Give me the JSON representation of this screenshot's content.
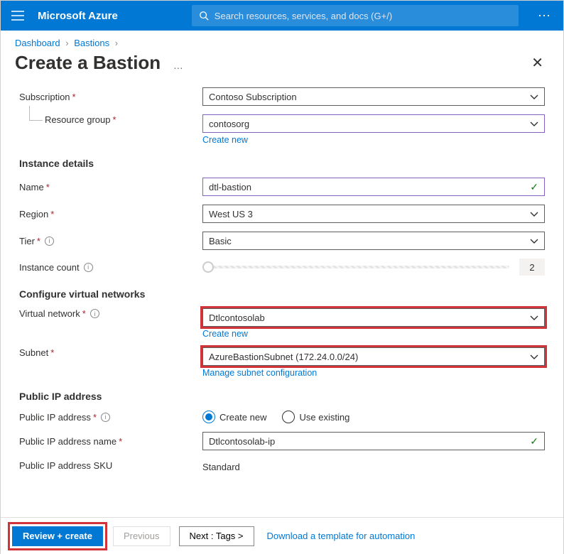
{
  "topbar": {
    "brand": "Microsoft Azure",
    "search_placeholder": "Search resources, services, and docs (G+/)"
  },
  "breadcrumb": {
    "item1": "Dashboard",
    "item2": "Bastions"
  },
  "page": {
    "title": "Create a Bastion"
  },
  "labels": {
    "subscription": "Subscription",
    "resource_group": "Resource group",
    "instance_details": "Instance details",
    "name": "Name",
    "region": "Region",
    "tier": "Tier",
    "instance_count": "Instance count",
    "configure_vnet": "Configure virtual networks",
    "vnet": "Virtual network",
    "subnet": "Subnet",
    "public_ip_section": "Public IP address",
    "public_ip": "Public IP address",
    "public_ip_name": "Public IP address name",
    "public_ip_sku": "Public IP address SKU"
  },
  "values": {
    "subscription": "Contoso Subscription",
    "resource_group": "contosorg",
    "name": "dtl-bastion",
    "region": "West US 3",
    "tier": "Basic",
    "instance_count": "2",
    "vnet": "Dtlcontosolab",
    "subnet": "AzureBastionSubnet (172.24.0.0/24)",
    "public_ip_name": "Dtlcontosolab-ip",
    "public_ip_sku": "Standard"
  },
  "links": {
    "create_new": "Create new",
    "manage_subnet": "Manage subnet configuration",
    "download_template": "Download a template for automation"
  },
  "radio": {
    "create_new": "Create new",
    "use_existing": "Use existing"
  },
  "buttons": {
    "review_create": "Review + create",
    "previous": "Previous",
    "next": "Next : Tags >"
  }
}
